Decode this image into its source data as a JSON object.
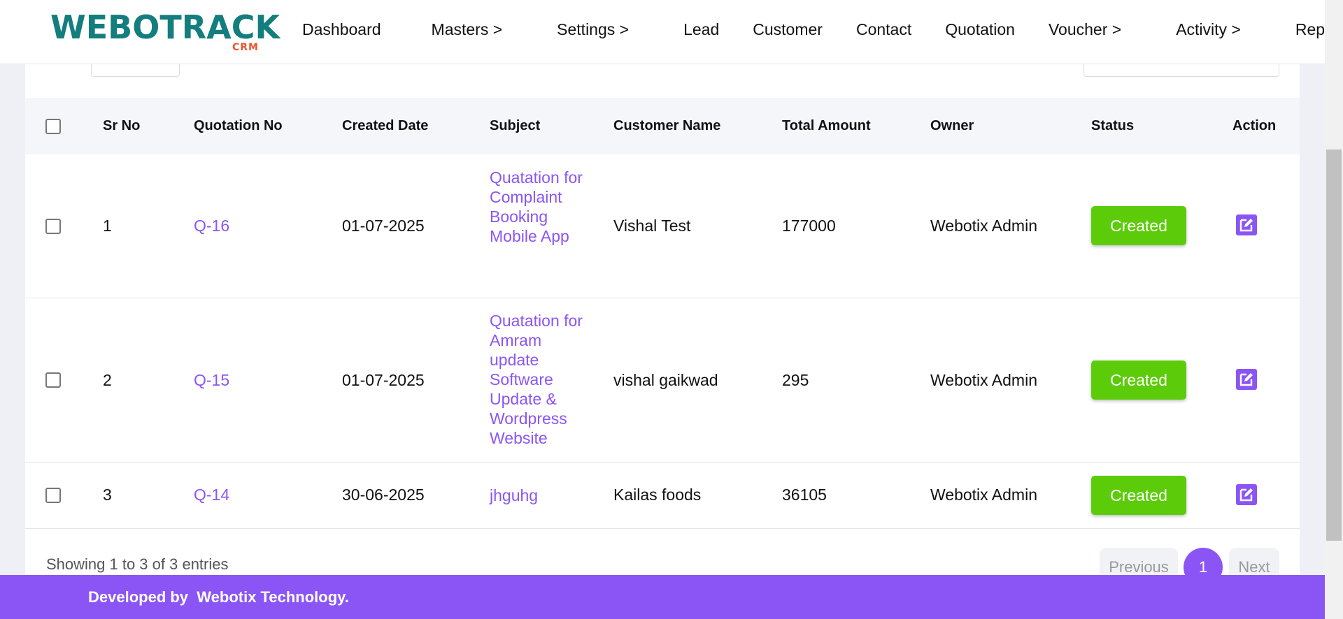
{
  "brand": {
    "name": "WEBOTRACK",
    "sub": "CRM"
  },
  "nav": [
    {
      "label": "Dashboard"
    },
    {
      "label": "Masters >"
    },
    {
      "label": "Settings >"
    },
    {
      "label": "Lead"
    },
    {
      "label": "Customer"
    },
    {
      "label": "Contact"
    },
    {
      "label": "Quotation"
    },
    {
      "label": "Voucher >"
    },
    {
      "label": "Activity >"
    },
    {
      "label": "Repo"
    }
  ],
  "table": {
    "headers": {
      "sr_no": "Sr No",
      "quotation_no": "Quotation No",
      "created_date": "Created Date",
      "subject": "Subject",
      "customer_name": "Customer Name",
      "total_amount": "Total Amount",
      "owner": "Owner",
      "status": "Status",
      "action": "Action"
    },
    "rows": [
      {
        "sr": "1",
        "quotation": "Q-16",
        "date": "01-07-2025",
        "subject": "Quatation for Complaint Booking Mobile App",
        "customer": "Vishal Test",
        "amount": "177000",
        "owner": "Webotix Admin",
        "status": "Created"
      },
      {
        "sr": "2",
        "quotation": "Q-15",
        "date": "01-07-2025",
        "subject": "Quatation for Amram update Software Update & Wordpress Website",
        "customer": "vishal gaikwad",
        "amount": "295",
        "owner": "Webotix Admin",
        "status": "Created"
      },
      {
        "sr": "3",
        "quotation": "Q-14",
        "date": "30-06-2025",
        "subject": "jhguhg",
        "customer": "Kailas foods",
        "amount": "36105",
        "owner": "Webotix Admin",
        "status": "Created"
      }
    ]
  },
  "pagination": {
    "info": "Showing 1 to 3 of 3 entries",
    "previous": "Previous",
    "current": "1",
    "next": "Next"
  },
  "footer": {
    "prefix": "Developed by ",
    "company": "Webotix Technology."
  },
  "colors": {
    "accent": "#8b55f5",
    "status_green": "#5ccc0a",
    "brand_teal": "#147d7d",
    "brand_orange": "#e9572b"
  }
}
